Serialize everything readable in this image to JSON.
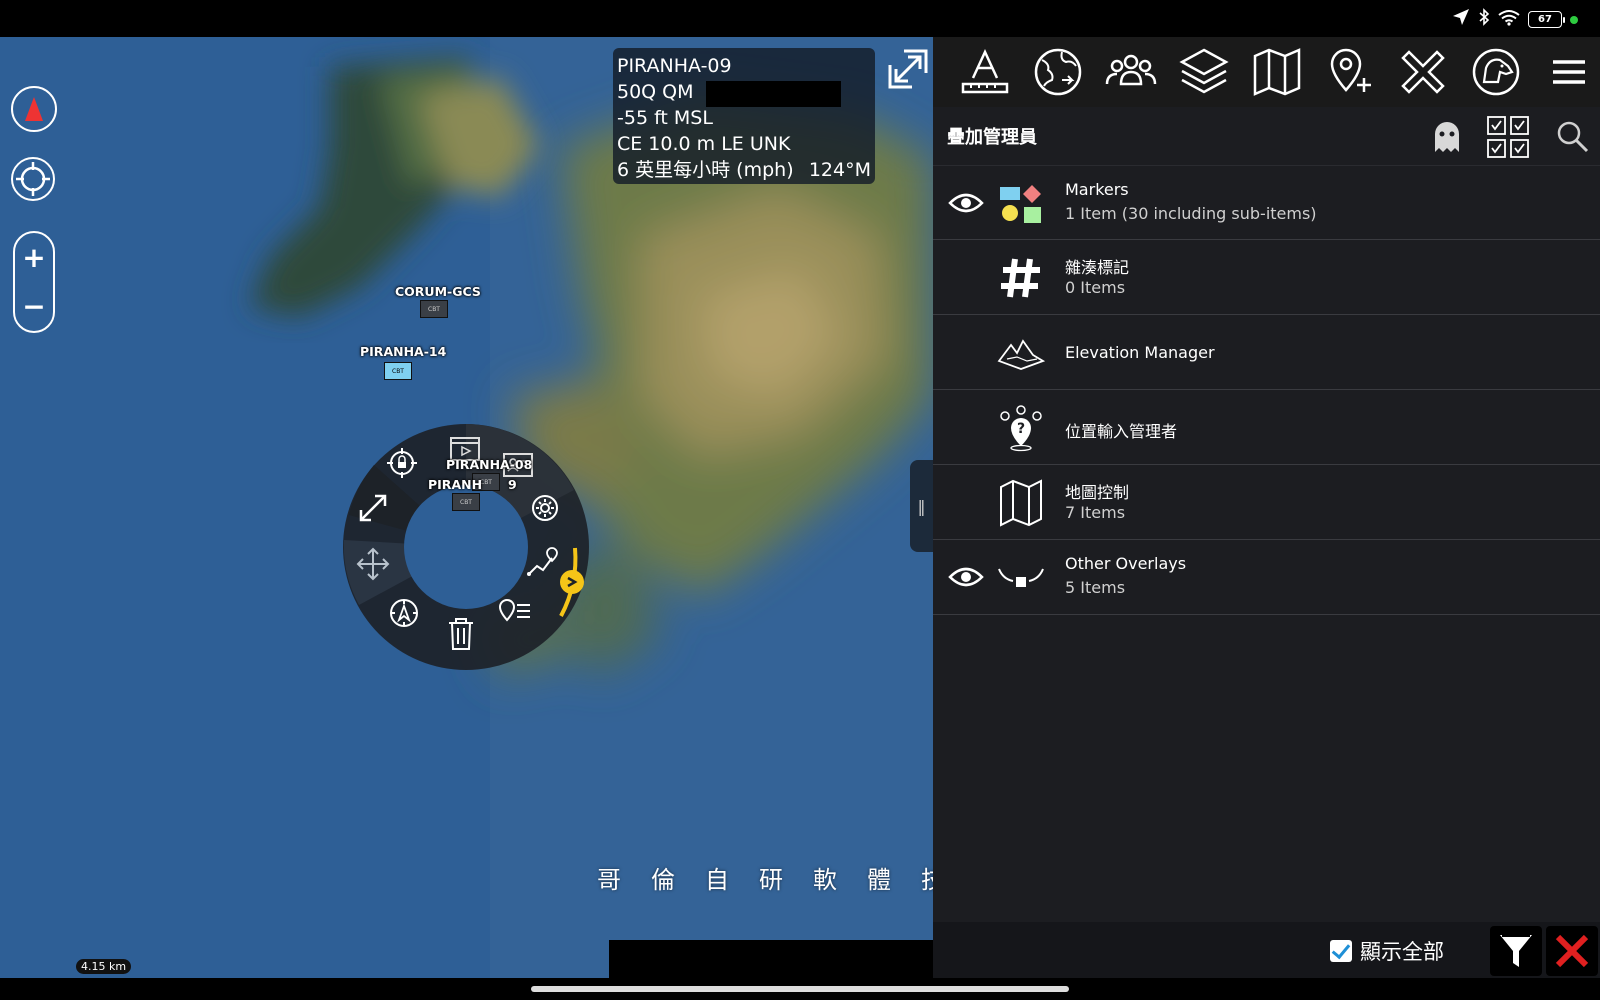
{
  "status": {
    "battery": "67"
  },
  "map": {
    "info": {
      "callsign": "PIRANHA-09",
      "grid": "50Q QM",
      "altitude": "-55 ft MSL",
      "error": "CE 10.0 m LE UNK",
      "speed": "6 英里每小時 (mph)",
      "heading": "124°M"
    },
    "markers": [
      {
        "label": "CORUM-GCS",
        "icon": "CBT",
        "color": "#3a3f46"
      },
      {
        "label": "PIRANHA-14",
        "icon": "CBT",
        "color": "#7fd0f0"
      },
      {
        "label": "PIRANHA-08",
        "icon": "CBT",
        "color": "#3a3f46"
      },
      {
        "label": "PIRANH",
        "label_tail": "9",
        "icon": "CBT",
        "color": "#3a3f46"
      }
    ],
    "watermark": "哥倫自研軟體技術",
    "scale_label": "4.15 km"
  },
  "toolbar": {
    "items": [
      "ruler-icon",
      "globe-icon",
      "team-icon",
      "layers-icon",
      "map-icon",
      "add-pin-icon",
      "close-x-icon",
      "dog-icon",
      "menu-icon"
    ]
  },
  "panel": {
    "title": "疊加管理員",
    "items": [
      {
        "title": "Markers",
        "sub": "1 Item (30 including sub-items)",
        "visible": true
      },
      {
        "title": "雜湊標記",
        "sub": "0 Items",
        "visible": false
      },
      {
        "title": "Elevation Manager",
        "sub": "",
        "visible": false
      },
      {
        "title": "位置輸入管理者",
        "sub": "",
        "visible": false
      },
      {
        "title": "地圖控制",
        "sub": "7 Items",
        "visible": false
      },
      {
        "title": "Other Overlays",
        "sub": "5 Items",
        "visible": true
      }
    ],
    "footer": {
      "show_all": "顯示全部"
    }
  },
  "colors": {
    "accent_yellow": "#f5c518",
    "close_red": "#e02020",
    "map_water": "#2e5f96"
  }
}
